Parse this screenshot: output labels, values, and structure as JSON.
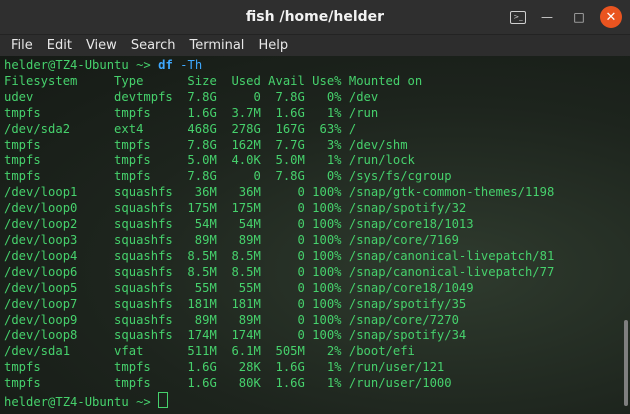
{
  "window": {
    "title": "fish  /home/helder"
  },
  "menubar": {
    "items": [
      "File",
      "Edit",
      "View",
      "Search",
      "Terminal",
      "Help"
    ]
  },
  "terminal": {
    "prompt_user": "helder@TZ4-Ubuntu",
    "prompt_cwd": "~>",
    "command": "df",
    "command_arg": "-Th",
    "header": "Filesystem     Type      Size  Used Avail Use% Mounted on",
    "rows": [
      "udev           devtmpfs  7.8G     0  7.8G   0% /dev",
      "tmpfs          tmpfs     1.6G  3.7M  1.6G   1% /run",
      "/dev/sda2      ext4      468G  278G  167G  63% /",
      "tmpfs          tmpfs     7.8G  162M  7.7G   3% /dev/shm",
      "tmpfs          tmpfs     5.0M  4.0K  5.0M   1% /run/lock",
      "tmpfs          tmpfs     7.8G     0  7.8G   0% /sys/fs/cgroup",
      "/dev/loop1     squashfs   36M   36M     0 100% /snap/gtk-common-themes/1198",
      "/dev/loop0     squashfs  175M  175M     0 100% /snap/spotify/32",
      "/dev/loop2     squashfs   54M   54M     0 100% /snap/core18/1013",
      "/dev/loop3     squashfs   89M   89M     0 100% /snap/core/7169",
      "/dev/loop4     squashfs  8.5M  8.5M     0 100% /snap/canonical-livepatch/81",
      "/dev/loop6     squashfs  8.5M  8.5M     0 100% /snap/canonical-livepatch/77",
      "/dev/loop5     squashfs   55M   55M     0 100% /snap/core18/1049",
      "/dev/loop7     squashfs  181M  181M     0 100% /snap/spotify/35",
      "/dev/loop9     squashfs   89M   89M     0 100% /snap/core/7270",
      "/dev/loop8     squashfs  174M  174M     0 100% /snap/spotify/34",
      "/dev/sda1      vfat      511M  6.1M  505M   2% /boot/efi",
      "tmpfs          tmpfs     1.6G   28K  1.6G   1% /run/user/121",
      "tmpfs          tmpfs     1.6G   80K  1.6G   1% /run/user/1000"
    ]
  },
  "colors": {
    "close_button": "#e95420",
    "terminal_text": "#46d16c",
    "command": "#3ea9ff"
  }
}
